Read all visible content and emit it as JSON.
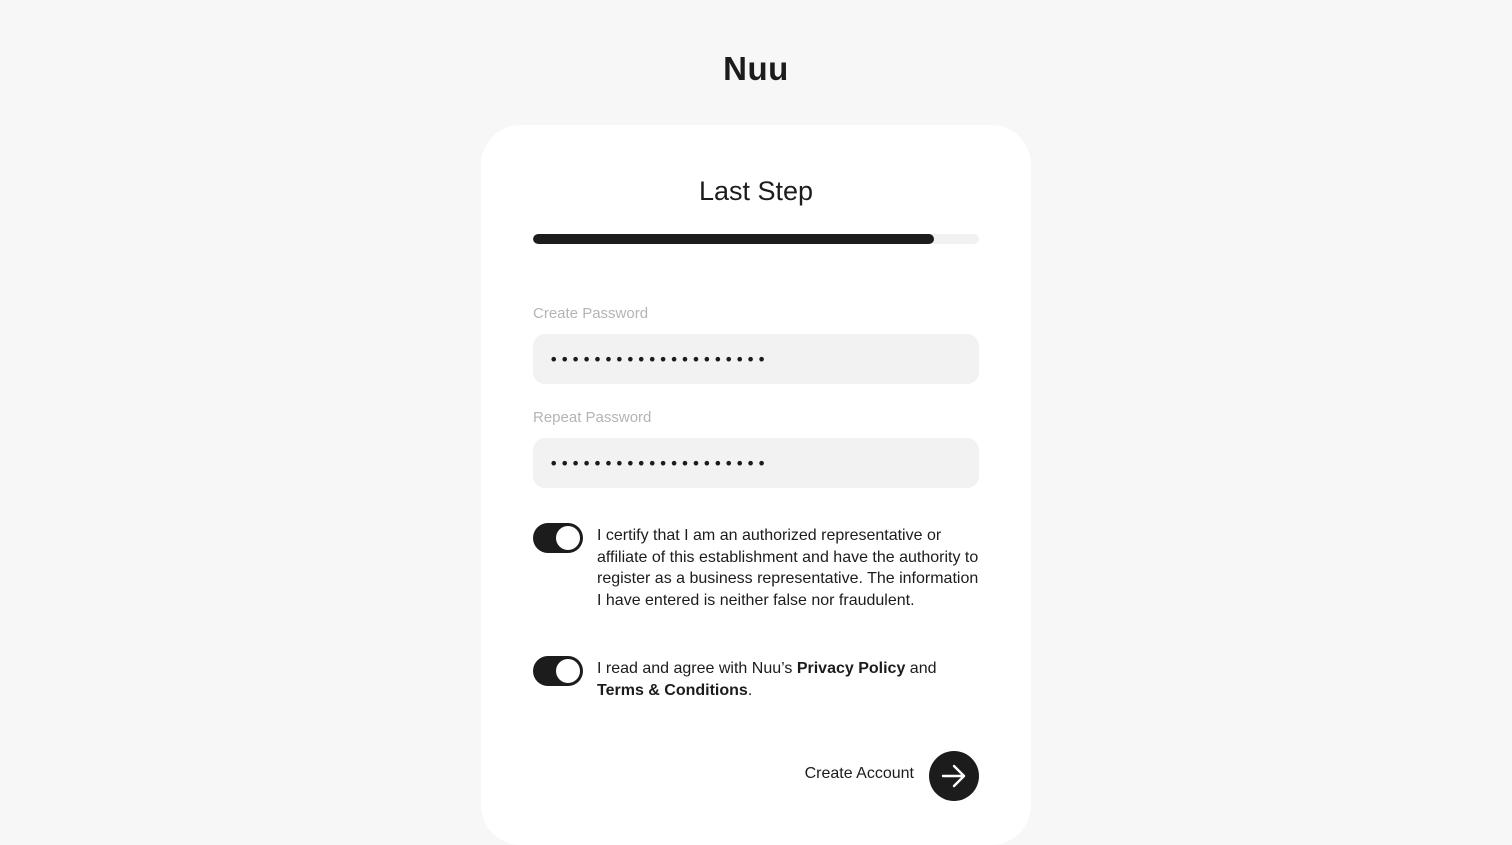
{
  "brand": {
    "logo_text": "Nuu"
  },
  "step": {
    "title": "Last Step",
    "progress_fraction": 0.9
  },
  "form": {
    "create_password": {
      "label": "Create Password",
      "value": "password12345678Abc!"
    },
    "repeat_password": {
      "label": "Repeat Password",
      "value": "password12345678Abc!"
    },
    "certify": {
      "checked": true,
      "text": "I certify that I am an authorized representative or affiliate of this establishment and have the authority to register as a business representative. The information I have entered is neither false nor fraudulent."
    },
    "agree": {
      "checked": true,
      "text_prefix": "I read and agree with Nuu’s ",
      "privacy_link": "Privacy Policy",
      "text_middle": " and ",
      "terms_link": "Terms & Conditions",
      "text_suffix": "."
    }
  },
  "submit": {
    "label": "Create Account",
    "icon": "arrow-right-icon"
  },
  "colors": {
    "background": "#f7f7f7",
    "card": "#ffffff",
    "accent": "#1c1c1c",
    "input_bg": "#f2f2f2",
    "label": "#b4b4b4"
  }
}
